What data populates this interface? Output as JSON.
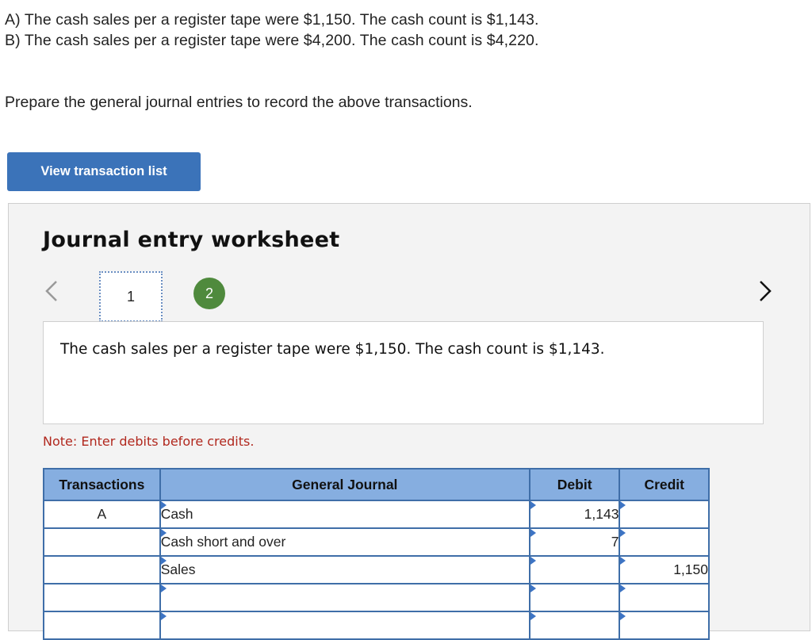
{
  "problem": {
    "line_a": "A) The cash sales per a register tape were $1,150. The cash count is $1,143.",
    "line_b": "B) The cash sales per a register tape were $4,200. The cash count is $4,220.",
    "instruction": "Prepare the general journal entries to record the above transactions."
  },
  "buttons": {
    "view_transaction_list": "View transaction list"
  },
  "worksheet": {
    "title": "Journal entry worksheet",
    "steps": [
      "1",
      "2"
    ],
    "current_step": "1",
    "description": "The cash sales per a register tape were $1,150. The cash count is $1,143.",
    "note": "Note: Enter debits before credits.",
    "nav_icons": {
      "prev": "chevron-left-icon",
      "next": "chevron-right-icon"
    }
  },
  "journal": {
    "headers": {
      "transactions": "Transactions",
      "general_journal": "General Journal",
      "debit": "Debit",
      "credit": "Credit"
    },
    "rows": [
      {
        "transaction": "A",
        "account": "Cash",
        "debit": "1,143",
        "credit": ""
      },
      {
        "transaction": "",
        "account": "Cash short and over",
        "debit": "7",
        "credit": ""
      },
      {
        "transaction": "",
        "account": "Sales",
        "debit": "",
        "credit": "1,150"
      },
      {
        "transaction": "",
        "account": "",
        "debit": "",
        "credit": ""
      },
      {
        "transaction": "",
        "account": "",
        "debit": "",
        "credit": ""
      }
    ]
  },
  "colors": {
    "button": "#3b73b9",
    "header": "#86aee0",
    "border": "#3f6ea8",
    "step_2": "#4f8a3d",
    "note": "#b1281e"
  }
}
